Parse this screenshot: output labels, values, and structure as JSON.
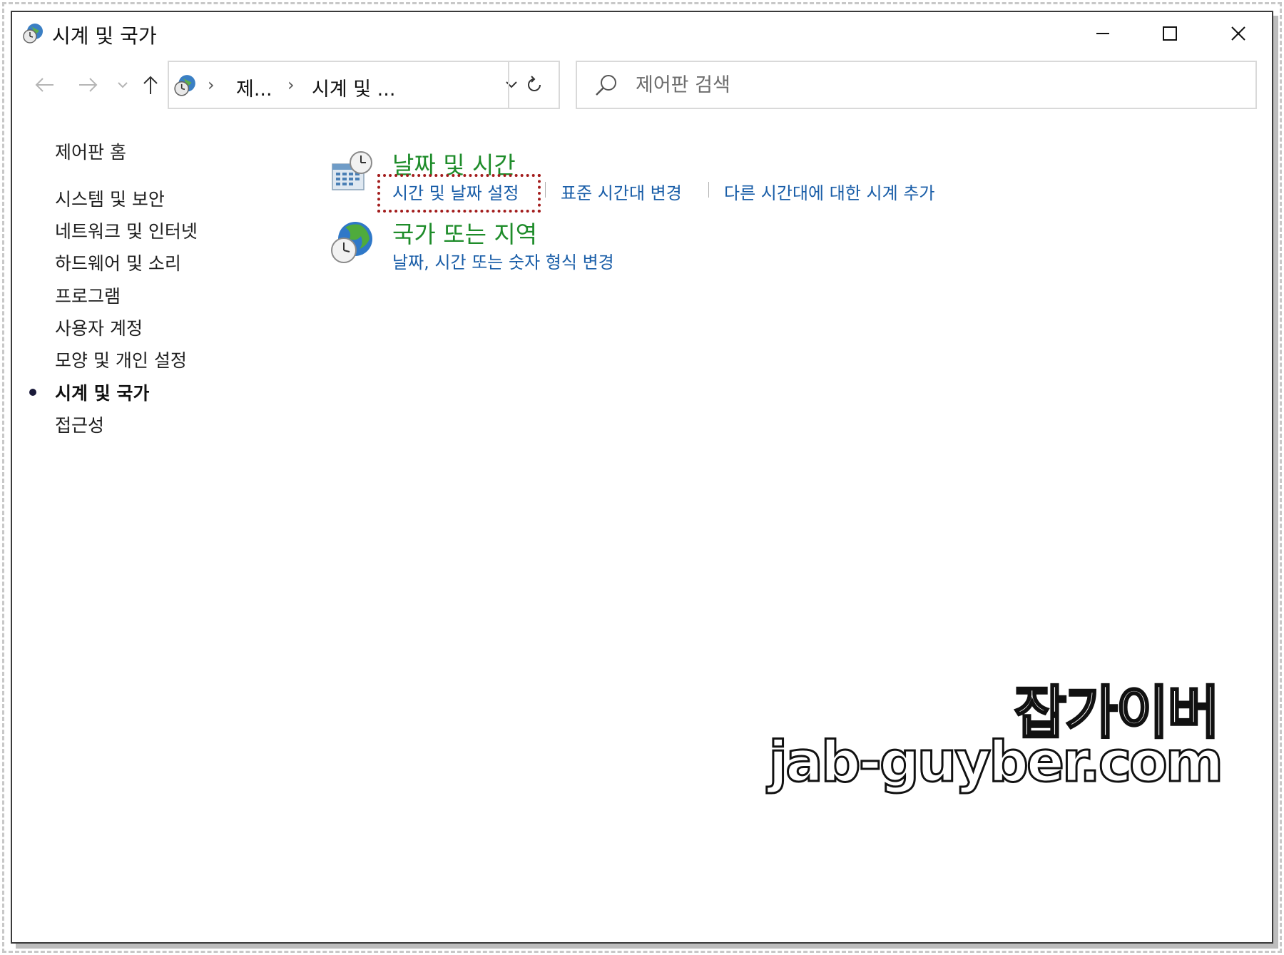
{
  "window": {
    "title": "시계 및 국가",
    "icon": "clock-globe-icon"
  },
  "titlebar_buttons": {
    "minimize": "minimize-icon",
    "maximize": "maximize-icon",
    "close": "close-icon"
  },
  "nav": {
    "back": "back-arrow-icon",
    "forward": "forward-arrow-icon",
    "recent": "chevron-down-icon",
    "up": "up-arrow-icon"
  },
  "address": {
    "crumbs": [
      "제...",
      "시계 및 ..."
    ],
    "separator": "›"
  },
  "search": {
    "placeholder": "제어판 검색"
  },
  "sidebar": {
    "items": [
      {
        "label": "제어판 홈",
        "active": false
      },
      {
        "label": "시스템 및 보안",
        "active": false
      },
      {
        "label": "네트워크 및 인터넷",
        "active": false
      },
      {
        "label": "하드웨어 및 소리",
        "active": false
      },
      {
        "label": "프로그램",
        "active": false
      },
      {
        "label": "사용자 계정",
        "active": false
      },
      {
        "label": "모양 및 개인 설정",
        "active": false
      },
      {
        "label": "시계 및 국가",
        "active": true
      },
      {
        "label": "접근성",
        "active": false
      }
    ]
  },
  "main": {
    "categories": [
      {
        "title": "날짜 및 시간",
        "icon": "calendar-clock-icon",
        "links": [
          "시간 및 날짜 설정",
          "표준 시간대 변경",
          "다른 시간대에 대한 시계 추가"
        ]
      },
      {
        "title": "국가 또는 지역",
        "icon": "globe-clock-icon",
        "links": [
          "날짜, 시간 또는 숫자 형식 변경"
        ]
      }
    ]
  },
  "watermark": {
    "line1": "잡가이버",
    "line2": "jab-guyber.com"
  },
  "colors": {
    "category_title": "#1e8c2a",
    "link": "#1a5ea8",
    "highlight": "#a31d1d"
  }
}
